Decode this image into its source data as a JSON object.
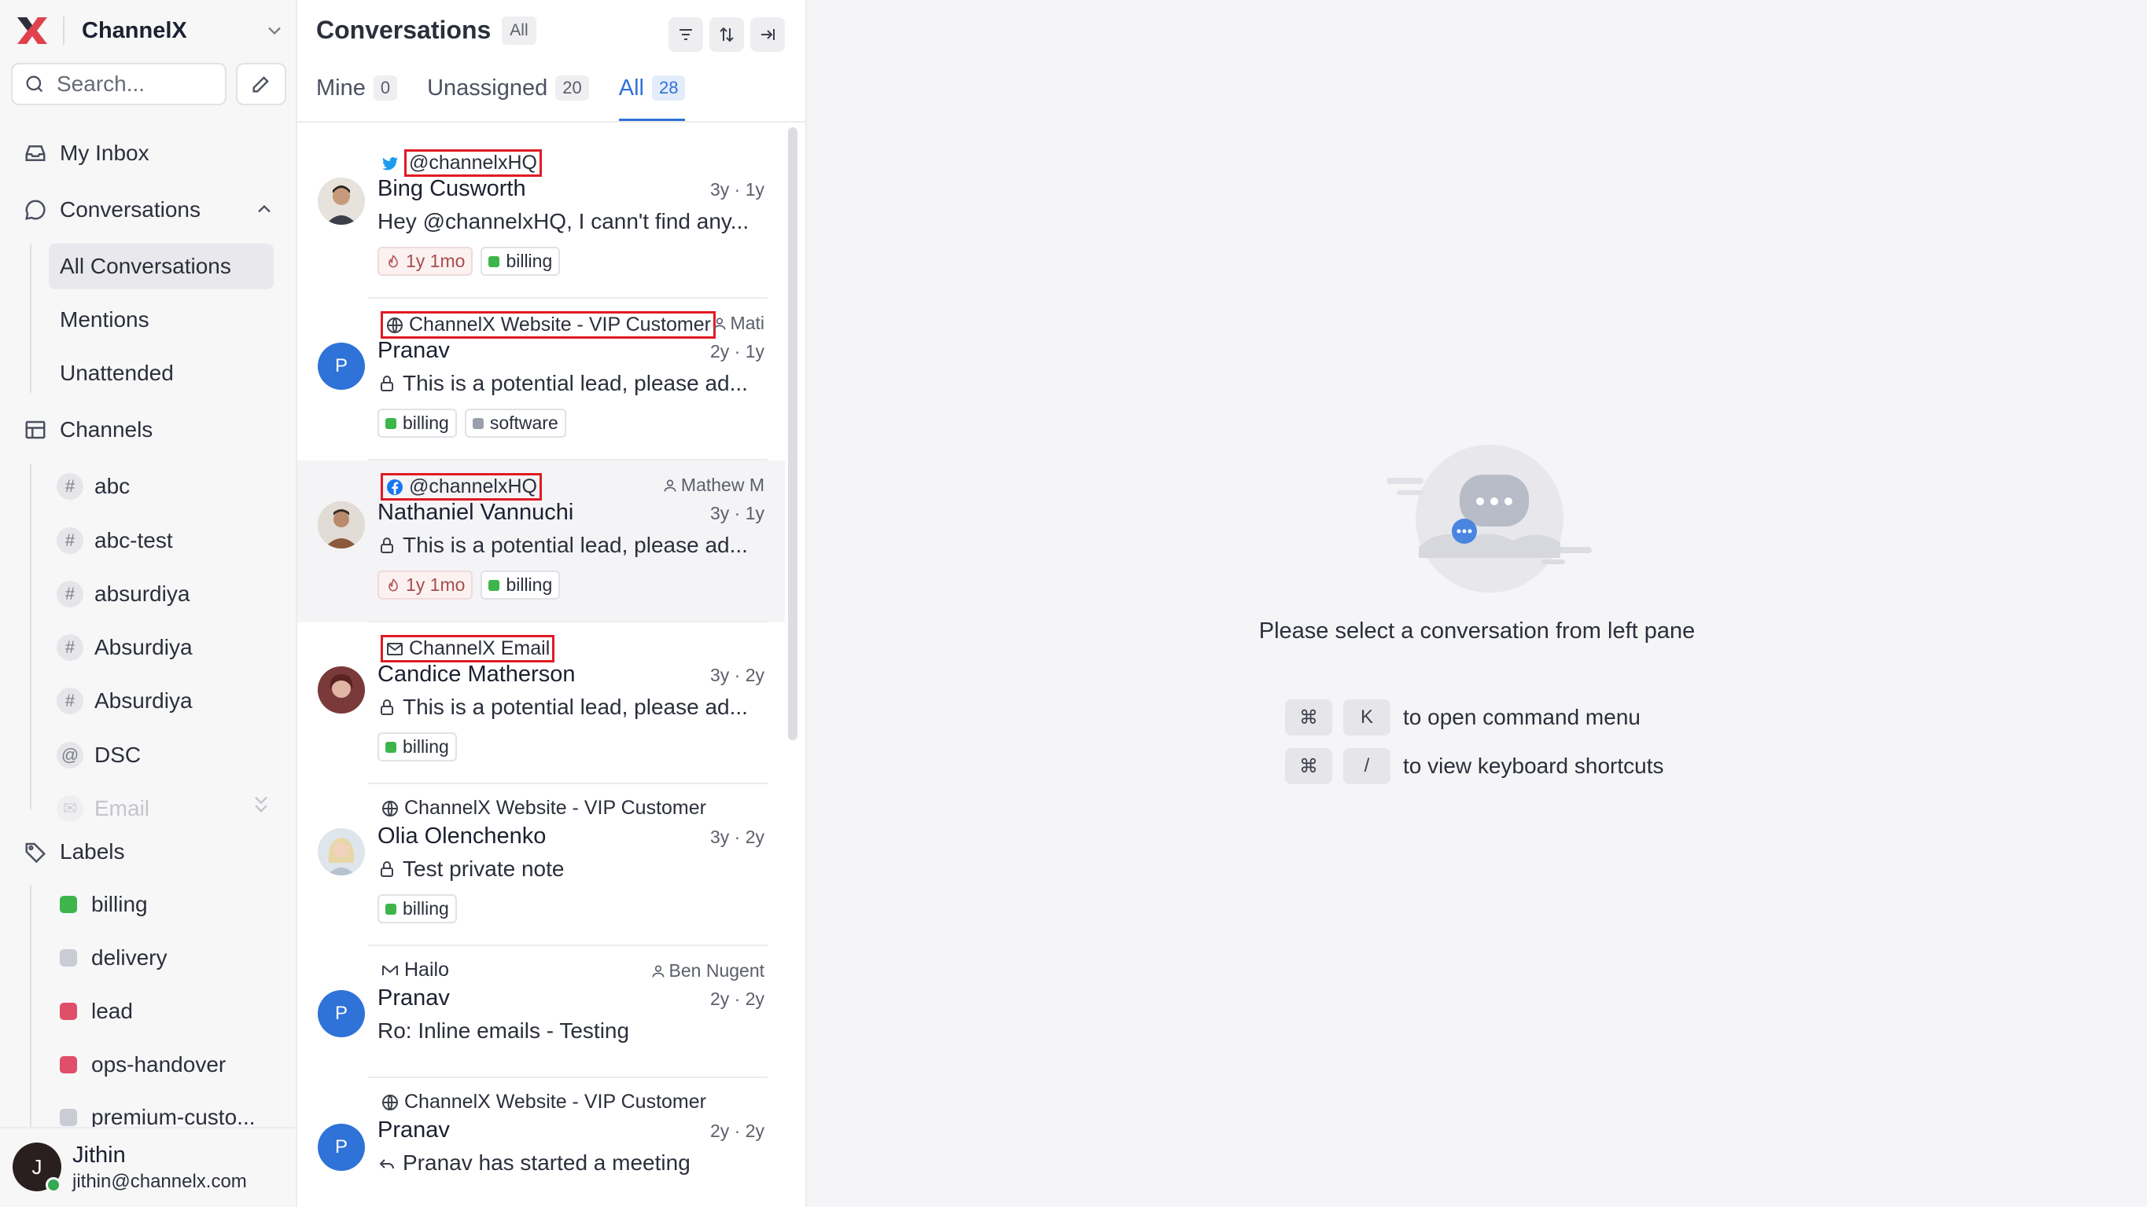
{
  "brand": {
    "name": "ChannelX"
  },
  "search": {
    "placeholder": "Search..."
  },
  "nav": {
    "my_inbox": "My Inbox",
    "conversations": "Conversations",
    "conversation_views": [
      "All Conversations",
      "Mentions",
      "Unattended"
    ],
    "channels_title": "Channels",
    "channels": [
      {
        "icon": "#",
        "label": "abc"
      },
      {
        "icon": "#",
        "label": "abc-test"
      },
      {
        "icon": "#",
        "label": "absurdiya"
      },
      {
        "icon": "#",
        "label": "Absurdiya"
      },
      {
        "icon": "#",
        "label": "Absurdiya"
      },
      {
        "icon": "@",
        "label": "DSC"
      },
      {
        "icon": "✉",
        "label": "Email"
      }
    ],
    "labels_title": "Labels",
    "labels": [
      {
        "label": "billing",
        "color": "#3db54a"
      },
      {
        "label": "delivery",
        "color": "#c9ccd3"
      },
      {
        "label": "lead",
        "color": "#e04f6a"
      },
      {
        "label": "ops-handover",
        "color": "#e04f6a"
      },
      {
        "label": "premium-custo...",
        "color": "#c9ccd3"
      }
    ]
  },
  "profile": {
    "initial": "J",
    "name": "Jithin",
    "email": "jithin@channelx.com"
  },
  "list": {
    "title": "Conversations",
    "status": "All",
    "tabs": [
      {
        "label": "Mine",
        "count": "0"
      },
      {
        "label": "Unassigned",
        "count": "20"
      },
      {
        "label": "All",
        "count": "28"
      }
    ],
    "conversations": [
      {
        "inbox": "@channelxHQ",
        "inbox_icon": "twitter-icon",
        "assignee": "",
        "name": "Bing Cusworth",
        "time": "3y · 1y",
        "message": "Hey @channelxHQ, I cann't find any...",
        "sla": "1y 1mo",
        "labels": [
          "billing"
        ]
      },
      {
        "inbox": "ChannelX Website - VIP Customer",
        "inbox_icon": "globe-icon",
        "assignee": "Mati",
        "name": "Pranav",
        "time": "2y · 1y",
        "message": "This is a potential lead, please ad...",
        "sla": "",
        "labels": [
          "billing",
          "software"
        ]
      },
      {
        "inbox": "@channelxHQ",
        "inbox_icon": "facebook-icon",
        "assignee": "Mathew M",
        "name": "Nathaniel Vannuchi",
        "time": "3y · 1y",
        "message": "This is a potential lead, please ad...",
        "sla": "1y 1mo",
        "labels": [
          "billing"
        ]
      },
      {
        "inbox": "ChannelX Email",
        "inbox_icon": "mail-icon",
        "assignee": "",
        "name": "Candice Matherson",
        "time": "3y · 2y",
        "message": "This is a potential lead, please ad...",
        "sla": "",
        "labels": [
          "billing"
        ]
      },
      {
        "inbox": "ChannelX Website - VIP Customer",
        "inbox_icon": "globe-icon",
        "assignee": "",
        "name": "Olia Olenchenko",
        "time": "3y · 2y",
        "message": "Test private note",
        "sla": "",
        "labels": [
          "billing"
        ]
      },
      {
        "inbox": "Hailo",
        "inbox_icon": "mail-icon",
        "assignee": "Ben Nugent",
        "name": "Pranav",
        "time": "2y · 2y",
        "message": "Ro: Inline emails - Testing",
        "sla": "",
        "labels": []
      },
      {
        "inbox": "ChannelX Website - VIP Customer",
        "inbox_icon": "globe-icon",
        "assignee": "",
        "name": "Pranav",
        "time": "2y · 2y",
        "message": "Pranav has started a meeting",
        "sla": "",
        "labels": []
      }
    ],
    "avatar_initial": "P"
  },
  "empty": {
    "message": "Please select a conversation from left pane",
    "shortcuts": [
      {
        "keys": [
          "⌘",
          "K"
        ],
        "label": "to open command menu"
      },
      {
        "keys": [
          "⌘",
          "/"
        ],
        "label": "to view keyboard shortcuts"
      }
    ]
  },
  "colors": {
    "accent": "#2f72d8",
    "highlight_box": "#e01b24",
    "label_billing": "#3db54a",
    "label_software": "#9aa0ab"
  }
}
